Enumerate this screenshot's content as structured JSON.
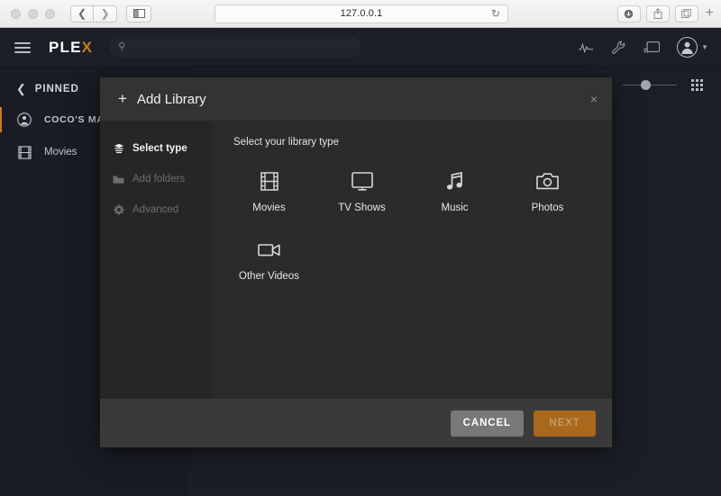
{
  "browser": {
    "url": "127.0.0.1",
    "back_icon": "chevron-left-icon",
    "forward_icon": "chevron-right-icon",
    "sidebar_icon": "sidebar-toggle-icon",
    "reload_icon": "reload-icon",
    "download_icon": "download-icon",
    "share_icon": "share-icon",
    "tabs_icon": "tab-overview-icon",
    "new_tab_label": "+"
  },
  "header": {
    "menu_icon": "hamburger-icon",
    "logo_main": "PLE",
    "logo_accent": "X",
    "search_placeholder": "",
    "search_value": "",
    "search_icon": "search-icon",
    "activity_icon": "activity-pulse-icon",
    "settings_icon": "wrench-icon",
    "cast_icon": "cast-icon",
    "avatar_icon": "user-avatar-icon",
    "caret_icon": "chevron-down-icon"
  },
  "sidebar": {
    "pinned_label": "PINNED",
    "back_icon": "chevron-left-icon",
    "items": [
      {
        "label": "COCO'S MAC",
        "icon": "user-avatar-icon",
        "active": true
      },
      {
        "label": "Movies",
        "icon": "film-strip-icon",
        "active": false
      }
    ]
  },
  "content_tools": {
    "zoom_slider_icon": "size-slider",
    "grid_view_icon": "grid-view-icon"
  },
  "modal": {
    "title": "Add Library",
    "title_plus": "+",
    "close_label": "×",
    "steps": [
      {
        "label": "Select type",
        "icon": "layers-icon",
        "active": true
      },
      {
        "label": "Add folders",
        "icon": "folder-icon",
        "active": false
      },
      {
        "label": "Advanced",
        "icon": "gear-icon",
        "active": false
      }
    ],
    "pane_label": "Select your library type",
    "types": [
      {
        "label": "Movies",
        "icon": "film-strip-icon"
      },
      {
        "label": "TV Shows",
        "icon": "monitor-icon"
      },
      {
        "label": "Music",
        "icon": "music-note-icon"
      },
      {
        "label": "Photos",
        "icon": "camera-icon"
      },
      {
        "label": "Other Videos",
        "icon": "video-camera-icon"
      }
    ],
    "cancel_label": "CANCEL",
    "next_label": "NEXT"
  },
  "colors": {
    "plex_accent": "#cc7b19",
    "app_background": "#1b1e26",
    "modal_background": "#2b2b2b",
    "next_button": "#a9681c"
  }
}
